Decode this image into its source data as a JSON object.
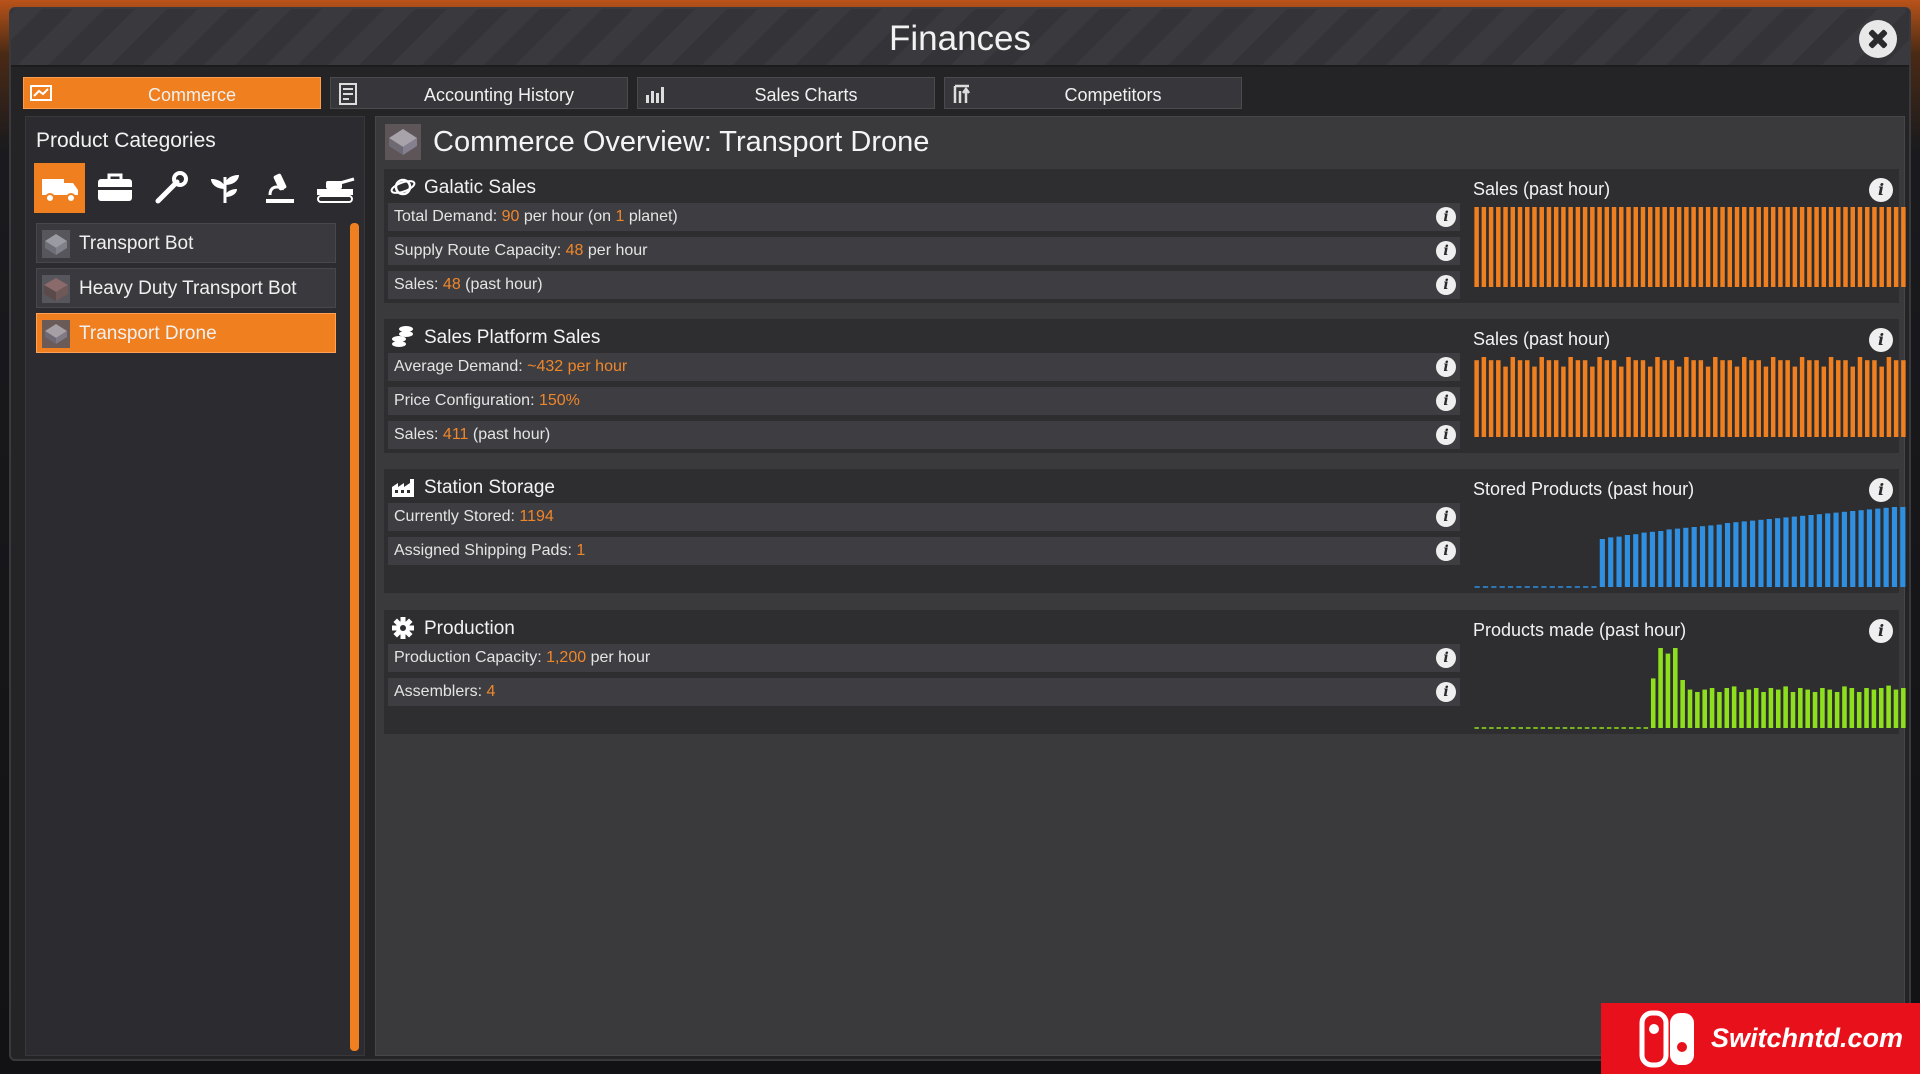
{
  "window": {
    "title": "Finances"
  },
  "tabs": [
    {
      "label": "Commerce",
      "icon": "commerce-icon",
      "active": true
    },
    {
      "label": "Accounting History",
      "icon": "ledger-icon",
      "active": false
    },
    {
      "label": "Sales Charts",
      "icon": "bar-chart-icon",
      "active": false
    },
    {
      "label": "Competitors",
      "icon": "competitors-icon",
      "active": false
    }
  ],
  "sidebar": {
    "title": "Product Categories",
    "category_icons": [
      "truck-icon",
      "toolbox-icon",
      "wrench-icon",
      "plant-icon",
      "microscope-icon",
      "tank-icon"
    ],
    "active_category": 0,
    "products": [
      {
        "label": "Transport Bot",
        "active": false
      },
      {
        "label": "Heavy Duty Transport Bot",
        "active": false
      },
      {
        "label": "Transport Drone",
        "active": true
      }
    ]
  },
  "main": {
    "title": "Commerce Overview: Transport Drone",
    "sections": [
      {
        "title": "Galatic Sales",
        "icon": "planet-icon",
        "rows": [
          {
            "parts": [
              "Total Demand: ",
              "90",
              " per hour (on ",
              "1",
              " planet)"
            ]
          },
          {
            "parts": [
              "Supply Route Capacity: ",
              "48",
              " per hour"
            ]
          },
          {
            "parts": [
              "Sales: ",
              "48",
              " (past hour)"
            ]
          }
        ],
        "chart": {
          "title": "Sales (past hour)",
          "color": "#f07f1f",
          "values": [
            1,
            1,
            1,
            1,
            1,
            1,
            1,
            1,
            1,
            1,
            1,
            1,
            1,
            1,
            1,
            1,
            1,
            1,
            1,
            1,
            1,
            1,
            1,
            1,
            1,
            1,
            1,
            1,
            1,
            1,
            1,
            1,
            1,
            1,
            1,
            1,
            1,
            1,
            1,
            1,
            1,
            1,
            1,
            1,
            1,
            1,
            1,
            1,
            1,
            1,
            1,
            1,
            1,
            1,
            1,
            1,
            1,
            1,
            1,
            1
          ]
        }
      },
      {
        "title": "Sales Platform Sales",
        "icon": "coins-icon",
        "rows": [
          {
            "parts": [
              "Average Demand: ",
              "~432 per hour",
              ""
            ]
          },
          {
            "parts": [
              "Price Configuration: ",
              "150%",
              ""
            ]
          },
          {
            "parts": [
              "Sales: ",
              "411",
              " (past hour)"
            ]
          }
        ],
        "chart": {
          "title": "Sales (past hour)",
          "color": "#f07f1f",
          "values": [
            0.96,
            1,
            0.96,
            0.96,
            0.88,
            1,
            0.96,
            0.96,
            0.88,
            1,
            0.96,
            0.96,
            0.88,
            1,
            0.96,
            0.96,
            0.88,
            1,
            0.96,
            0.96,
            0.88,
            1,
            0.96,
            0.96,
            0.88,
            1,
            0.96,
            0.96,
            0.88,
            1,
            0.96,
            0.96,
            0.88,
            1,
            0.96,
            0.96,
            0.88,
            1,
            0.96,
            0.96,
            0.88,
            1,
            0.96,
            0.96,
            0.88,
            1,
            0.96,
            0.96,
            0.88,
            1,
            0.96,
            0.96,
            0.88,
            1,
            0.96,
            0.96,
            0.88,
            1,
            0.96,
            0.96
          ]
        }
      },
      {
        "title": "Station Storage",
        "icon": "factory-icon",
        "rows": [
          {
            "parts": [
              "Currently Stored: ",
              "1194",
              ""
            ]
          },
          {
            "parts": [
              "Assigned Shipping Pads: ",
              "1",
              ""
            ]
          }
        ],
        "chart": {
          "title": "Stored Products (past hour)",
          "color": "#2f8fe0",
          "values": [
            0,
            0,
            0,
            0,
            0,
            0,
            0,
            0,
            0,
            0,
            0,
            0,
            0,
            0,
            0,
            0.6,
            0.62,
            0.63,
            0.65,
            0.66,
            0.68,
            0.69,
            0.7,
            0.72,
            0.73,
            0.74,
            0.75,
            0.76,
            0.77,
            0.78,
            0.8,
            0.81,
            0.82,
            0.83,
            0.84,
            0.85,
            0.86,
            0.87,
            0.88,
            0.89,
            0.9,
            0.91,
            0.92,
            0.93,
            0.94,
            0.95,
            0.96,
            0.97,
            0.98,
            0.99,
            1,
            1
          ]
        }
      },
      {
        "title": "Production",
        "icon": "gear-icon",
        "rows": [
          {
            "parts": [
              "Production Capacity: ",
              "1,200",
              " per hour"
            ]
          },
          {
            "parts": [
              "Assemblers: ",
              "4",
              ""
            ]
          }
        ],
        "chart": {
          "title": "Products made (past hour)",
          "color": "#8fe01c",
          "values": [
            0,
            0,
            0,
            0,
            0,
            0,
            0,
            0,
            0,
            0,
            0,
            0,
            0,
            0,
            0,
            0,
            0,
            0,
            0,
            0,
            0,
            0,
            0,
            0,
            0.62,
            1,
            0.93,
            1,
            0.6,
            0.48,
            0.45,
            0.48,
            0.5,
            0.45,
            0.5,
            0.52,
            0.45,
            0.48,
            0.5,
            0.45,
            0.5,
            0.48,
            0.52,
            0.45,
            0.5,
            0.48,
            0.45,
            0.5,
            0.48,
            0.45,
            0.52,
            0.5,
            0.45,
            0.5,
            0.48,
            0.5,
            0.53,
            0.48,
            0.5
          ]
        }
      }
    ]
  },
  "watermark": {
    "text": "Switchntd.com"
  }
}
